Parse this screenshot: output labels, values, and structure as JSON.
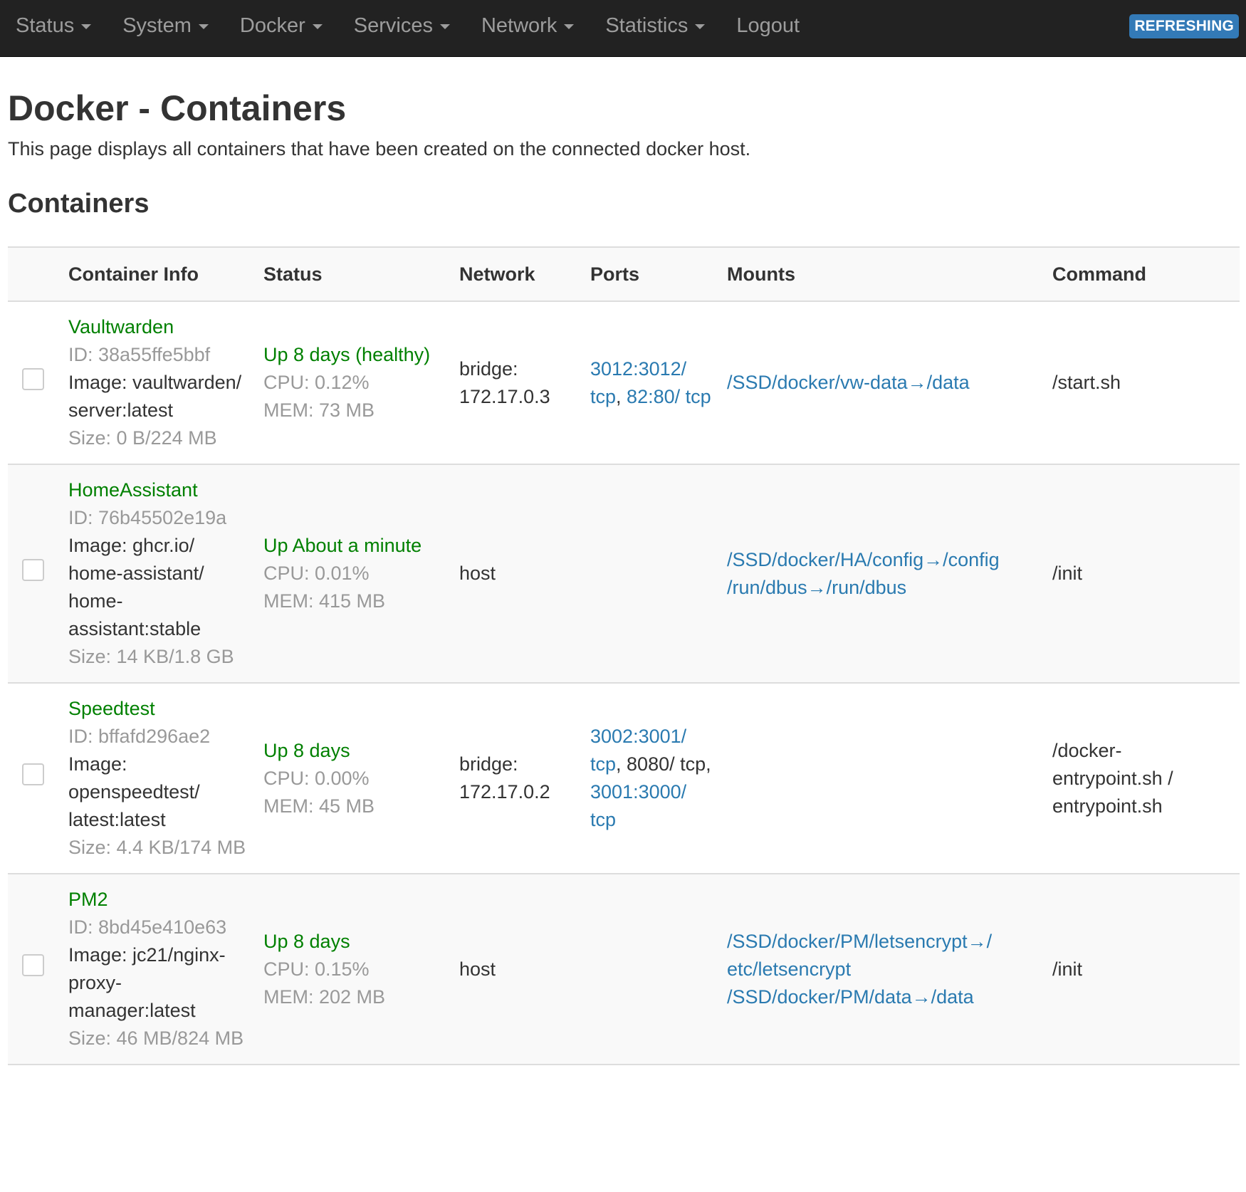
{
  "nav": {
    "items": [
      "Status",
      "System",
      "Docker",
      "Services",
      "Network",
      "Statistics"
    ],
    "logout": "Logout",
    "badge": "REFRESHING"
  },
  "page": {
    "title": "Docker - Containers",
    "description": "This page displays all containers that have been created on the connected docker host.",
    "section_title": "Containers"
  },
  "table": {
    "headers": {
      "info": "Container Info",
      "status": "Status",
      "network": "Network",
      "ports": "Ports",
      "mounts": "Mounts",
      "command": "Command"
    },
    "rows": [
      {
        "name": "Vaultwarden",
        "id": "ID: 38a55ffe5bbf",
        "image": "Image: vaultwarden/ server:latest",
        "size": "Size: 0 B/224 MB",
        "status": "Up 8 days (healthy)",
        "cpu": "CPU: 0.12%",
        "mem": "MEM: 73 MB",
        "network": "bridge: 172.17.0.3",
        "ports": [
          {
            "text": "3012:3012/ tcp",
            "link": true
          },
          {
            "text": ", ",
            "link": false
          },
          {
            "text": "82:80/ tcp",
            "link": true
          }
        ],
        "mounts": [
          "/SSD/docker/vw-data→/data"
        ],
        "command": "/start.sh"
      },
      {
        "name": "HomeAssistant",
        "id": "ID: 76b45502e19a",
        "image": "Image: ghcr.io/ home-assistant/ home- assistant:stable",
        "size": "Size: 14 KB/1.8 GB",
        "status": "Up About a minute",
        "cpu": "CPU: 0.01%",
        "mem": "MEM: 415 MB",
        "network": "host",
        "ports": [],
        "mounts": [
          "/SSD/docker/HA/config→/config",
          "/run/dbus→/run/dbus"
        ],
        "command": "/init"
      },
      {
        "name": "Speedtest",
        "id": "ID: bffafd296ae2",
        "image": "Image: openspeedtest/ latest:latest",
        "size": "Size: 4.4 KB/174 MB",
        "status": "Up 8 days",
        "cpu": "CPU: 0.00%",
        "mem": "MEM: 45 MB",
        "network": "bridge: 172.17.0.2",
        "ports": [
          {
            "text": "3002:3001/ tcp",
            "link": true
          },
          {
            "text": ", 8080/ tcp, ",
            "link": false
          },
          {
            "text": "3001:3000/ tcp",
            "link": true
          }
        ],
        "mounts": [],
        "command": "/docker- entrypoint.sh / entrypoint.sh"
      },
      {
        "name": "PM2",
        "id": "ID: 8bd45e410e63",
        "image": "Image: jc21/nginx- proxy- manager:latest",
        "size": "Size: 46 MB/824 MB",
        "status": "Up 8 days",
        "cpu": "CPU: 0.15%",
        "mem": "MEM: 202 MB",
        "network": "host",
        "ports": [],
        "mounts": [
          "/SSD/docker/PM/letsencrypt→/ etc/letsencrypt",
          "/SSD/docker/PM/data→/data"
        ],
        "command": "/init"
      }
    ]
  }
}
